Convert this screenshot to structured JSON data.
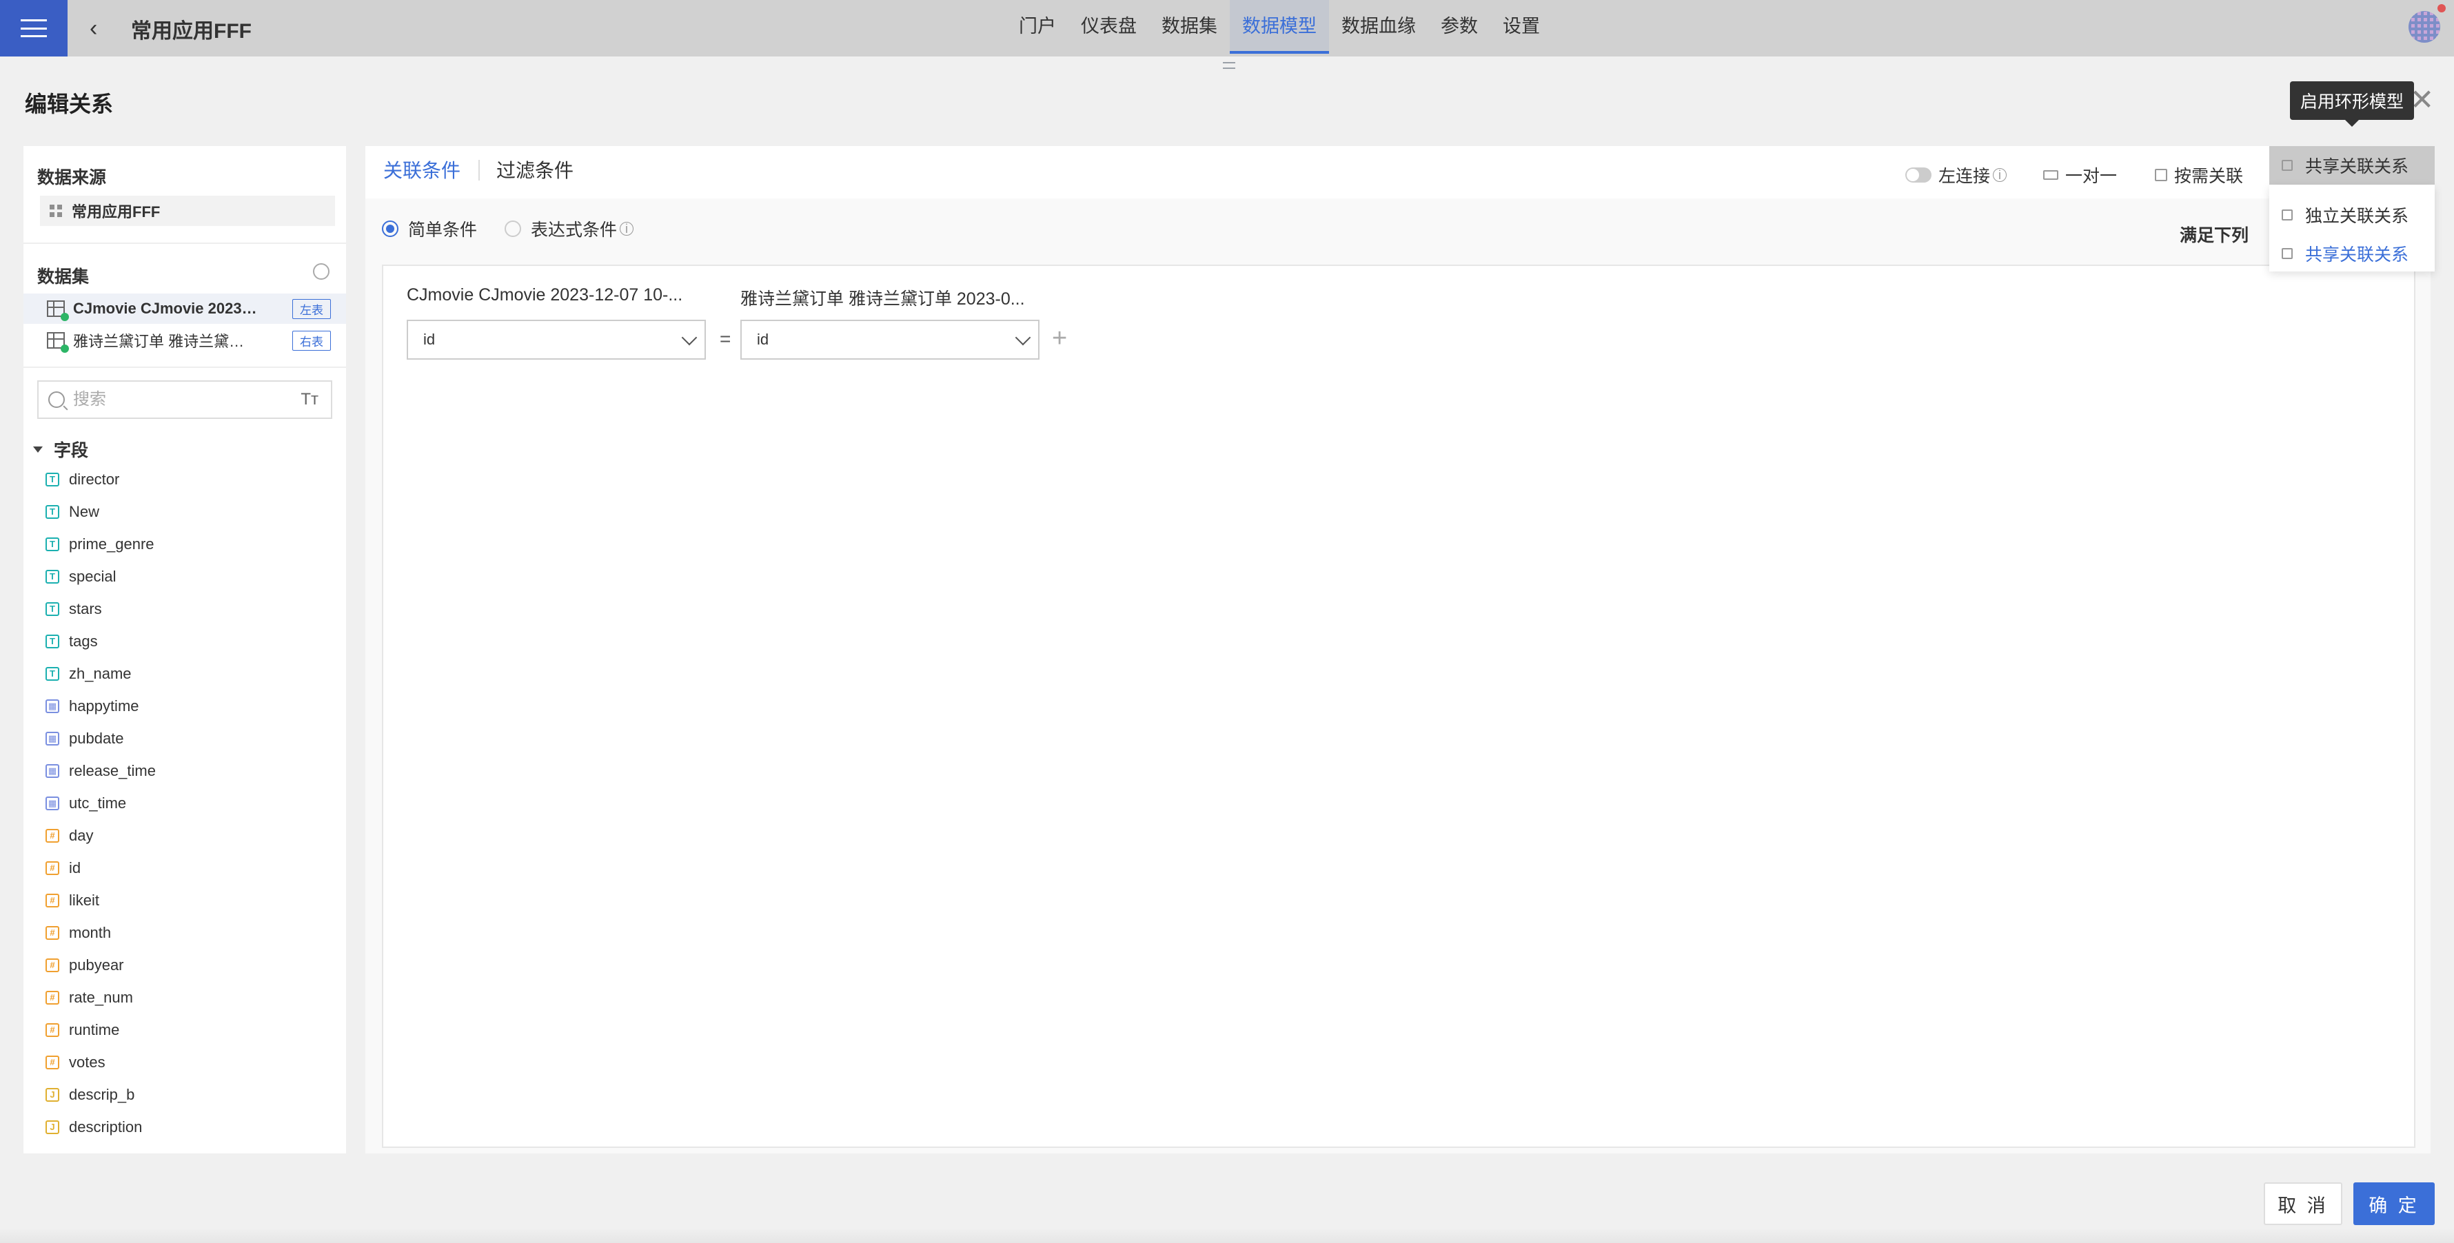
{
  "header": {
    "app_title": "常用应用FFF",
    "nav": [
      "门户",
      "仪表盘",
      "数据集",
      "数据模型",
      "数据血缘",
      "参数",
      "设置"
    ],
    "active_nav": "数据模型"
  },
  "modal": {
    "title": "编辑关系",
    "close_symbol": "✕"
  },
  "left_panel": {
    "source_title": "数据来源",
    "source_name": "常用应用FFF",
    "datasets_title": "数据集",
    "datasets": [
      {
        "name": "CJmovie CJmovie 2023-12-07 10-...",
        "tag": "左表",
        "selected": true
      },
      {
        "name": "雅诗兰黛订单 雅诗兰黛订单 2023-0...",
        "tag": "右表",
        "selected": false
      }
    ],
    "search_placeholder": "搜索",
    "fields_title": "字段",
    "fields": [
      {
        "name": "director",
        "type": "text"
      },
      {
        "name": "New",
        "type": "text"
      },
      {
        "name": "prime_genre",
        "type": "text"
      },
      {
        "name": "special",
        "type": "text"
      },
      {
        "name": "stars",
        "type": "text"
      },
      {
        "name": "tags",
        "type": "text"
      },
      {
        "name": "zh_name",
        "type": "text"
      },
      {
        "name": "happytime",
        "type": "date"
      },
      {
        "name": "pubdate",
        "type": "date"
      },
      {
        "name": "release_time",
        "type": "date"
      },
      {
        "name": "utc_time",
        "type": "date"
      },
      {
        "name": "day",
        "type": "number"
      },
      {
        "name": "id",
        "type": "number"
      },
      {
        "name": "likeit",
        "type": "number"
      },
      {
        "name": "month",
        "type": "number"
      },
      {
        "name": "pubyear",
        "type": "number"
      },
      {
        "name": "rate_num",
        "type": "number"
      },
      {
        "name": "runtime",
        "type": "number"
      },
      {
        "name": "votes",
        "type": "number"
      },
      {
        "name": "descrip_b",
        "type": "json"
      },
      {
        "name": "description",
        "type": "json"
      }
    ]
  },
  "right_panel": {
    "tabs": [
      "关联条件",
      "过滤条件"
    ],
    "active_tab": "关联条件",
    "toolbar": {
      "left_join": "左连接",
      "one_to_one": "一对一",
      "on_demand": "按需关联",
      "share_relation": "共享关联关系"
    },
    "condition_modes": [
      "简单条件",
      "表达式条件"
    ],
    "selected_mode": "简单条件",
    "satisfy_text": "满足下列",
    "left_table_header": "CJmovie CJmovie 2023-12-07 10-...",
    "right_table_header": "雅诗兰黛订单 雅诗兰黛订单 2023-0...",
    "left_field": "id",
    "right_field": "id",
    "operator": "="
  },
  "relation_dropdown": {
    "options": [
      "独立关联关系",
      "共享关联关系"
    ],
    "selected": "共享关联关系"
  },
  "tooltip": "启用环形模型",
  "footer": {
    "cancel": "取 消",
    "ok": "确 定"
  },
  "colors": {
    "accent": "#3b6fd8",
    "menu_bg": "#3a5ec4",
    "text_type": "#1bb0b0",
    "date_type": "#7a8fe0",
    "number_type": "#f0a030"
  }
}
